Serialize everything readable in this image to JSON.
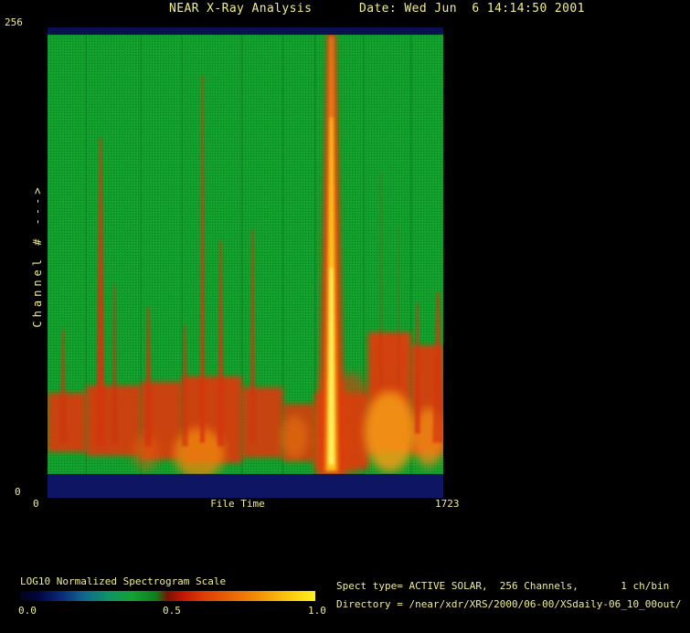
{
  "window": {
    "bg": "#000000",
    "text_color": "#f1ee8c"
  },
  "header": {
    "title": "NEAR X-Ray Analysis",
    "date": "Date: Wed Jun  6 14:14:50 2001"
  },
  "plot": {
    "y_label": "Channel # --->",
    "x_label": "File Time",
    "y_max_label": "256",
    "y_min_label": "0",
    "x_min_label": "0",
    "x_max_label": "1723"
  },
  "colorbar": {
    "label": "LOG10 Normalized Spectrogram Scale",
    "tick_labels": [
      "0.0",
      "0.5",
      "1.0"
    ],
    "gradient_stops": [
      [
        "0%",
        "#020216"
      ],
      [
        "6%",
        "#00063e"
      ],
      [
        "14%",
        "#0a2a7a"
      ],
      [
        "22%",
        "#0f6a8e"
      ],
      [
        "30%",
        "#0f9464"
      ],
      [
        "38%",
        "#12a232"
      ],
      [
        "46%",
        "#0f7d1d"
      ],
      [
        "50%",
        "#7a1403"
      ],
      [
        "55%",
        "#c21605"
      ],
      [
        "62%",
        "#dc3d05"
      ],
      [
        "70%",
        "#e85f05"
      ],
      [
        "80%",
        "#f28c07"
      ],
      [
        "90%",
        "#f9c40e"
      ],
      [
        "100%",
        "#fdf01f"
      ]
    ]
  },
  "info": {
    "line1": "Spect type= ACTIVE SOLAR,  256 Channels,       1 ch/bin",
    "line2": "Directory = /near/xdr/XRS/2000/06-00/XSdaily-06_10_00out/"
  },
  "chart_data": {
    "type": "heatmap",
    "title": "NEAR X-Ray Analysis",
    "xlabel": "File Time",
    "ylabel": "Channel #",
    "x_range": [
      0,
      1723
    ],
    "y_range": [
      0,
      256
    ],
    "scale": {
      "label": "LOG10 Normalized Spectrogram Scale",
      "range": [
        0.0,
        1.0
      ]
    },
    "background_channel_color": "#12a02c",
    "seam_color": "#0c7f24",
    "bands": [
      {
        "name": "top-empty-band",
        "ch": [
          252,
          256
        ],
        "color": "#0a1150"
      },
      {
        "name": "bottom-empty-band",
        "ch": [
          0,
          13
        ],
        "color": "#0e1562"
      }
    ],
    "seams_t": [
      168,
      407,
      586,
      846,
      1025,
      1165,
      1376,
      1583
    ],
    "continuum_segments": [
      {
        "t0": 0,
        "t1": 168,
        "ch_top": 57,
        "ch_bot": 25,
        "color": "#d93a10",
        "opacity": 0.92
      },
      {
        "t0": 168,
        "t1": 407,
        "ch_top": 61,
        "ch_bot": 23,
        "color": "#d93a10",
        "opacity": 0.92
      },
      {
        "t0": 407,
        "t1": 586,
        "ch_top": 63,
        "ch_bot": 21,
        "color": "#da3b10",
        "opacity": 0.92
      },
      {
        "t0": 586,
        "t1": 846,
        "ch_top": 66,
        "ch_bot": 19,
        "color": "#da3b10",
        "opacity": 0.93
      },
      {
        "t0": 846,
        "t1": 1025,
        "ch_top": 60,
        "ch_bot": 22,
        "color": "#d93a10",
        "opacity": 0.9
      },
      {
        "t0": 1025,
        "t1": 1165,
        "ch_top": 51,
        "ch_bot": 20,
        "color": "#d83a10",
        "opacity": 0.88
      },
      {
        "t0": 1165,
        "t1": 1396,
        "ch_top": 57,
        "ch_bot": 16,
        "color": "#d93a10",
        "opacity": 0.9
      },
      {
        "t0": 1396,
        "t1": 1583,
        "ch_top": 90,
        "ch_bot": 25,
        "color": "#dc3d0f",
        "opacity": 0.95
      },
      {
        "t0": 1583,
        "t1": 1723,
        "ch_top": 83,
        "ch_bot": 24,
        "color": "#db3c0f",
        "opacity": 0.93
      }
    ],
    "hotspots": [
      {
        "t": 430,
        "ch": 25,
        "rt": 60,
        "rch": 10,
        "color": "#e85d0d",
        "opacity": 0.5
      },
      {
        "t": 660,
        "ch": 24,
        "rt": 110,
        "rch": 14,
        "color": "#f0890e",
        "opacity": 0.75
      },
      {
        "t": 1075,
        "ch": 33,
        "rt": 60,
        "rch": 12,
        "color": "#ef7d10",
        "opacity": 0.5
      },
      {
        "t": 1236,
        "ch": 30,
        "rt": 70,
        "rch": 42,
        "color": "#e8560c",
        "opacity": 0.65
      },
      {
        "t": 1320,
        "ch": 40,
        "rt": 100,
        "rch": 28,
        "color": "#d8400e",
        "opacity": 0.6
      },
      {
        "t": 1490,
        "ch": 36,
        "rt": 110,
        "rch": 22,
        "color": "#f59b16",
        "opacity": 0.85
      },
      {
        "t": 1660,
        "ch": 33,
        "rt": 70,
        "rch": 16,
        "color": "#f08a12",
        "opacity": 0.8
      }
    ],
    "flares": [
      {
        "t": 68,
        "ch_top": 92,
        "w_top": 2,
        "w_base": 7,
        "ch_base": 30,
        "color": "#cc3410",
        "opacity": 0.7
      },
      {
        "t": 231,
        "ch_top": 196,
        "w_top": 2,
        "w_base": 10,
        "ch_base": 28,
        "color": "#d53511",
        "opacity": 0.88
      },
      {
        "t": 291,
        "ch_top": 116,
        "w_top": 2,
        "w_base": 6,
        "ch_base": 30,
        "color": "#c93310",
        "opacity": 0.62
      },
      {
        "t": 439,
        "ch_top": 104,
        "w_top": 2,
        "w_base": 8,
        "ch_base": 28,
        "color": "#d23410",
        "opacity": 0.8
      },
      {
        "t": 598,
        "ch_top": 94,
        "w_top": 2,
        "w_base": 7,
        "ch_base": 28,
        "color": "#d03410",
        "opacity": 0.7
      },
      {
        "t": 674,
        "ch_top": 230,
        "w_top": 1.6,
        "w_base": 5,
        "ch_base": 30,
        "color": "#d63611",
        "opacity": 0.85
      },
      {
        "t": 754,
        "ch_top": 140,
        "w_top": 2,
        "w_base": 7,
        "ch_base": 28,
        "color": "#d43511",
        "opacity": 0.8
      },
      {
        "t": 893,
        "ch_top": 146,
        "w_top": 2,
        "w_base": 6,
        "ch_base": 30,
        "color": "#d23410",
        "opacity": 0.72
      },
      {
        "t": 1452,
        "ch_top": 178,
        "w_top": 1.2,
        "w_base": 3,
        "ch_base": 60,
        "color": "#bb3310",
        "opacity": 0.35
      },
      {
        "t": 1528,
        "ch_top": 150,
        "w_top": 1,
        "w_base": 3,
        "ch_base": 60,
        "color": "#b53110",
        "opacity": 0.28
      },
      {
        "t": 1611,
        "ch_top": 106,
        "w_top": 1.6,
        "w_base": 6,
        "ch_base": 35,
        "color": "#d43511",
        "opacity": 0.8
      },
      {
        "t": 1700,
        "ch_top": 112,
        "w_top": 3,
        "w_base": 12,
        "ch_base": 30,
        "color": "#d53511",
        "opacity": 0.7
      }
    ],
    "main_flare": {
      "t": 1236,
      "layers": [
        {
          "ch_top": 256,
          "ch_base": 13,
          "w_top": 9,
          "w_base": 30,
          "color": "#da3b0c",
          "opacity": 0.92,
          "blur": 3
        },
        {
          "ch_top": 251,
          "ch_base": 14,
          "w_top": 5,
          "w_base": 16,
          "color": "#ef7e12",
          "opacity": 0.95,
          "blur": 2
        },
        {
          "ch_top": 207,
          "ch_base": 15,
          "w_top": 3,
          "w_base": 10,
          "color": "#fcca1d",
          "opacity": 0.95,
          "blur": 1.5
        },
        {
          "ch_top": 125,
          "ch_base": 18,
          "w_top": 3,
          "w_base": 6,
          "color": "#fff36a",
          "opacity": 0.92,
          "blur": 1.2
        }
      ]
    }
  }
}
